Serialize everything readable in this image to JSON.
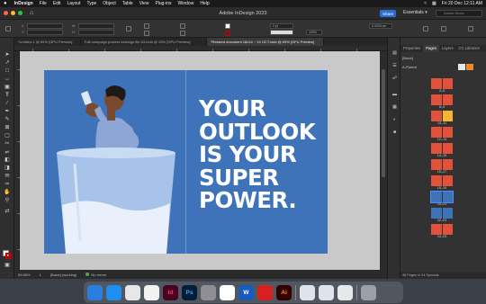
{
  "menubar": {
    "apple": "",
    "app_name": "InDesign",
    "items": [
      "File",
      "Edit",
      "Layout",
      "Type",
      "Object",
      "Table",
      "View",
      "Plug-ins",
      "Window",
      "Help"
    ],
    "datetime": "Fri 20 Dec 12:11 AM"
  },
  "appbar": {
    "title": "Adobe InDesign 2023",
    "share_label": "Share",
    "workspace": "Essentials",
    "search_placeholder": "Adobe Stock",
    "home_icon": "home-icon"
  },
  "controlbar": {
    "x_label": "X:",
    "y_label": "Y:",
    "w_label": "W:",
    "h_label": "H:",
    "zoom_field": "100%",
    "stroke_field": "0 pt",
    "measure_field": "0.4233 cm"
  },
  "tabs": [
    {
      "label": "*Untitled-1 @ 69% [GPU Preview]",
      "active": false
    },
    {
      "label": "Fall campaign posters indesign file A3.indd @ 26% [GPU Preview]",
      "active": false
    },
    {
      "label": "*Resized document 18x14 ~ 19 OCT.indd @ 69% [GPU Preview]",
      "active": true
    }
  ],
  "artwork": {
    "headline_lines": [
      "YOUR",
      "OUTLOOK",
      "IS YOUR",
      "SUPER",
      "POWER."
    ],
    "background_color": "#3e73b9"
  },
  "statusbar": {
    "zoom": "59.86%",
    "page": "1",
    "style": "[Basic] (working)",
    "preflight": "No errors"
  },
  "pages_panel": {
    "tabs": [
      "Properties",
      "Pages",
      "Layers",
      "CC Libraries"
    ],
    "active_tab": "Pages",
    "masters": [
      "[None]",
      "A-Parent"
    ],
    "spreads": [
      "4–5",
      "8–9",
      "10–11",
      "12–13",
      "14–15",
      "16–17",
      "18–19",
      "20–21",
      "22–23",
      "24–25"
    ],
    "selected_spread": "20–21",
    "footer": "48 Pages in 24 Spreads"
  },
  "dock": {
    "apps": [
      {
        "name": "finder",
        "label": "",
        "color": "#2a7de1"
      },
      {
        "name": "safari",
        "label": "",
        "color": "#1f8ef1"
      },
      {
        "name": "chrome",
        "label": "",
        "color": "#e7e7e7"
      },
      {
        "name": "photos",
        "label": "",
        "color": "#f2f2f2"
      },
      {
        "name": "indesign",
        "label": "Id",
        "color": "#49021f"
      },
      {
        "name": "photoshop",
        "label": "Ps",
        "color": "#001e36"
      },
      {
        "name": "system-preferences",
        "label": "",
        "color": "#8e8e93"
      },
      {
        "name": "calendar",
        "label": "",
        "color": "#ffffff"
      },
      {
        "name": "word",
        "label": "W",
        "color": "#185abd"
      },
      {
        "name": "acrobat",
        "label": "",
        "color": "#d7201f"
      },
      {
        "name": "illustrator",
        "label": "Ai",
        "color": "#330000"
      },
      {
        "name": "preview-window-1",
        "label": "",
        "color": "#dfe3ea"
      },
      {
        "name": "preview-window-2",
        "label": "",
        "color": "#dfe3ea"
      },
      {
        "name": "preview-window-3",
        "label": "",
        "color": "#e6e8ec"
      },
      {
        "name": "trash",
        "label": "",
        "color": "#9aa0a6"
      }
    ]
  }
}
